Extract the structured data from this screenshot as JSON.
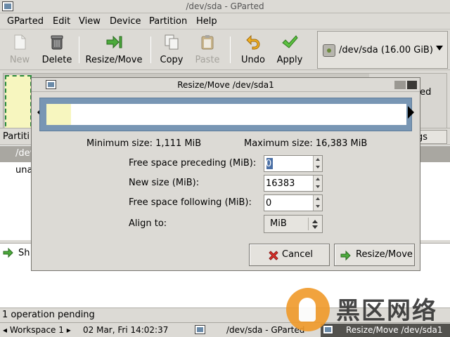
{
  "window": {
    "title": "/dev/sda - GParted"
  },
  "menubar": {
    "items": [
      "GParted",
      "Edit",
      "View",
      "Device",
      "Partition",
      "Help"
    ]
  },
  "toolbar": {
    "new_label": "New",
    "delete_label": "Delete",
    "resize_label": "Resize/Move",
    "copy_label": "Copy",
    "paste_label": "Paste",
    "undo_label": "Undo",
    "apply_label": "Apply"
  },
  "device_selector": {
    "value": "/dev/sda  (16.00 GiB)"
  },
  "partition_map": {
    "unallocated_text": "ted"
  },
  "partition_list": {
    "header_partition": "Partiti",
    "header_flags": "gs",
    "rows": [
      "/dev",
      "una"
    ]
  },
  "operations": {
    "item_text": "Sh"
  },
  "statusbar": {
    "text": "1 operation pending"
  },
  "taskbar": {
    "workspace": "◂ Workspace 1 ▸",
    "datetime": "02 Mar, Fri 14:02:37",
    "task1": "/dev/sda - GParted",
    "task2": "Resize/Move /dev/sda1"
  },
  "watermark": {
    "text": "黑区网络"
  },
  "dialog": {
    "title": "Resize/Move /dev/sda1",
    "min_size_text": "Minimum size: 1,111 MiB",
    "max_size_text": "Maximum size: 16,383 MiB",
    "used_fraction": 0.068,
    "free_preceding_label": "Free space preceding (MiB):",
    "free_preceding_value": "0",
    "new_size_label": "New size (MiB):",
    "new_size_value": "16383",
    "free_following_label": "Free space following (MiB):",
    "free_following_value": "0",
    "align_label": "Align to:",
    "align_value": "MiB",
    "cancel_label": "Cancel",
    "resize_label": "Resize/Move"
  },
  "colors": {
    "partition_fill": "#f7f6bf",
    "partition_border": "#2a8a3a",
    "frame_blue": "#7896b4",
    "selection": "#4a6fa5"
  }
}
